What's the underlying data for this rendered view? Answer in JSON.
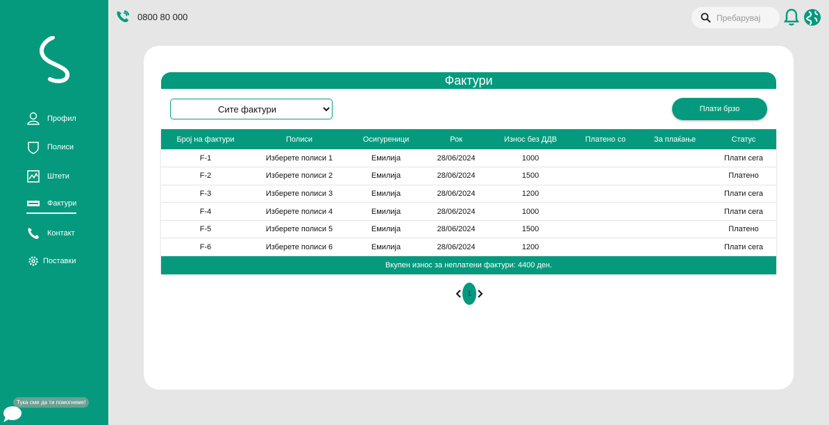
{
  "sidebar": {
    "items": [
      {
        "label": "Профил",
        "icon": "user-icon"
      },
      {
        "label": "Полиси",
        "icon": "shield-icon"
      },
      {
        "label": "Штети",
        "icon": "chart-icon"
      },
      {
        "label": "Фактури",
        "icon": "invoice-icon",
        "active": true
      },
      {
        "label": "Контакт",
        "icon": "phone-icon"
      },
      {
        "label": "Поставки",
        "icon": "gear-icon"
      }
    ],
    "help_text": "Тука сме да ти помогнеме!"
  },
  "header": {
    "phone": "0800 80 000",
    "search_placeholder": "Пребарувај"
  },
  "main": {
    "title": "Фактури",
    "filter_selected": "Сите фактури",
    "pay_fast_label": "Плати брзо",
    "table": {
      "headers": [
        "Број на фактури",
        "Полиси",
        "Осигуреници",
        "Рок",
        "Износ без ДДВ",
        "Платено со",
        "За плаќање",
        "Статус"
      ],
      "rows": [
        [
          "F-1",
          "Изберете полиси 1",
          "Емилија",
          "28/06/2024",
          "1000",
          "",
          "",
          "Плати сега"
        ],
        [
          "F-2",
          "Изберете полиси 2",
          "Емилија",
          "28/06/2024",
          "1500",
          "",
          "",
          "Платено"
        ],
        [
          "F-3",
          "Изберете полиси 3",
          "Емилија",
          "28/06/2024",
          "1200",
          "",
          "",
          "Плати сега"
        ],
        [
          "F-4",
          "Изберете полиси 4",
          "Емилија",
          "28/06/2024",
          "1000",
          "",
          "",
          "Плати сега"
        ],
        [
          "F-5",
          "Изберете полиси 5",
          "Емилија",
          "28/06/2024",
          "1500",
          "",
          "",
          "Платено"
        ],
        [
          "F-6",
          "Изберете полиси 6",
          "Емилија",
          "28/06/2024",
          "1200",
          "",
          "",
          "Плати сега"
        ]
      ],
      "footer": "Вкупен износ за неплатени фактури: 4400 ден."
    },
    "pagination": {
      "current": "1"
    }
  },
  "colors": {
    "accent": "#059a7e",
    "background": "#e6e6e6"
  }
}
